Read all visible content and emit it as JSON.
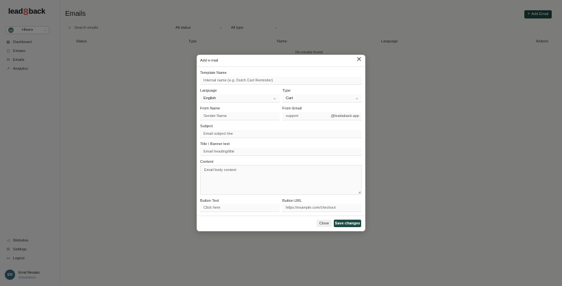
{
  "brand": {
    "logo_left": "lead",
    "logo_mid": "8",
    "logo_right": "back"
  },
  "store": {
    "avatar": "SH",
    "name": "Hbwra"
  },
  "nav": [
    {
      "icon": "▦",
      "label": "Dashboard"
    },
    {
      "icon": "◫",
      "label": "Emaws"
    },
    {
      "icon": "✉",
      "label": "Emails"
    },
    {
      "icon": "↗",
      "label": "Analytics"
    }
  ],
  "nav_bottom": [
    {
      "icon": "◁",
      "label": "Websites"
    },
    {
      "icon": "⚙",
      "label": "Settings"
    },
    {
      "icon": "↦",
      "label": "Logout"
    }
  ],
  "user": {
    "initials": "EN",
    "name": "Ernst Nevasix",
    "email": "@leadaback"
  },
  "page": {
    "title": "Emails",
    "add_button": "Add Email",
    "add_icon": "+"
  },
  "filters": {
    "search_icon": "⌕",
    "search_placeholder": "Search emails",
    "status": "All status",
    "type": "All type"
  },
  "table": {
    "columns": [
      "Status",
      "Type",
      "Name",
      "Language",
      "Actions"
    ],
    "empty_message": "No emails found"
  },
  "modal": {
    "title": "Add e-mail",
    "close_icon": "✕",
    "template_name_label": "Template Name",
    "template_name_placeholder": "Internal name (e.g. Dutch Cart Reminder)",
    "language_label": "Language",
    "language_value": "English",
    "type_label": "Type",
    "type_value": "Cart",
    "from_name_label": "From Name",
    "from_name_placeholder": "Sender Name",
    "from_email_label": "From Email",
    "from_email_value": "support",
    "from_email_suffix": "@leadaback.app",
    "subject_label": "Subject",
    "subject_placeholder": "Email subject line",
    "banner_label": "Title / Banner text",
    "banner_placeholder": "Email heading/title",
    "content_label": "Content",
    "content_placeholder": "Email body content",
    "button_text_label": "Button Text",
    "button_text_placeholder": "Click here",
    "button_url_label": "Button URL",
    "button_url_placeholder": "https://example.com/checkout",
    "close_button": "Close",
    "save_button": "Save changes"
  },
  "colors": {
    "accent": "#1f4d45",
    "logo_accent": "#e05a5a"
  }
}
